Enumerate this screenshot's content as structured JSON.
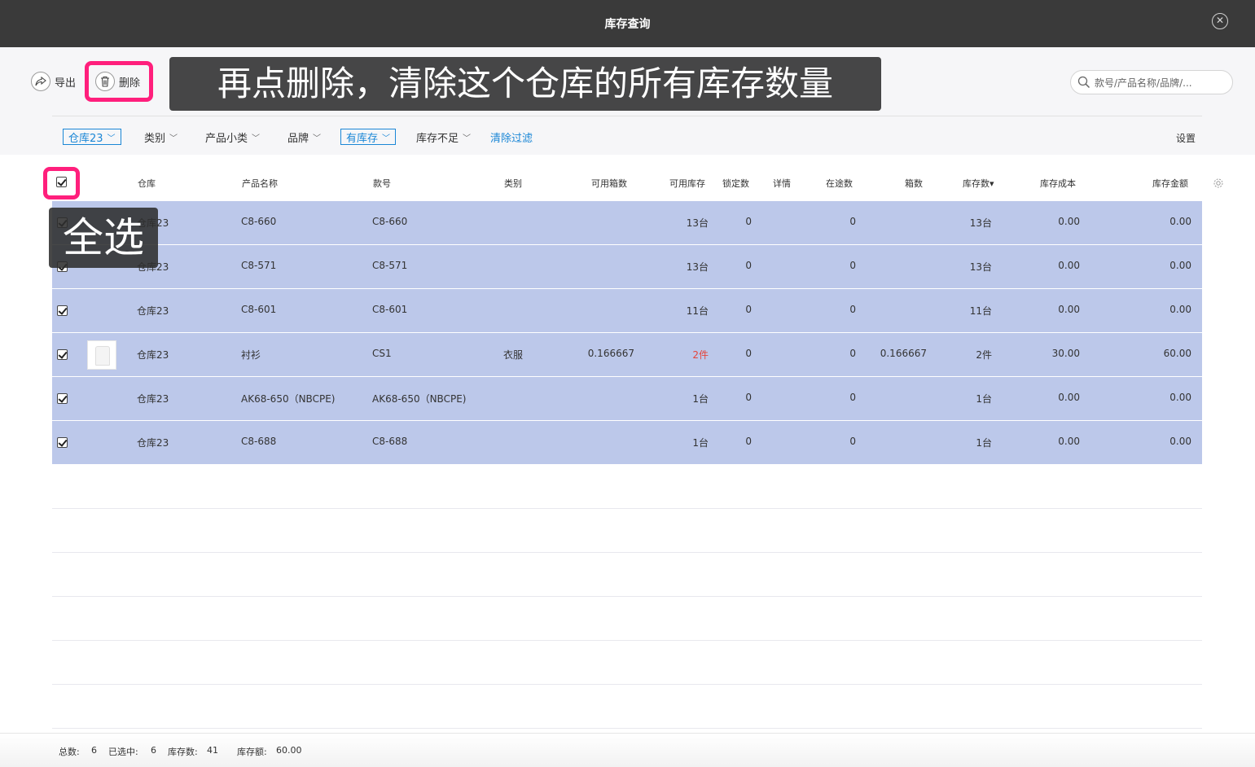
{
  "window": {
    "title": "库存查询"
  },
  "toolbar": {
    "export_label": "导出",
    "delete_label": "删除",
    "search_placeholder": "款号/产品名称/品牌/..."
  },
  "annotations": {
    "delete_caption": "再点删除，清除这个仓库的所有库存数量",
    "select_all_caption": "全选",
    "highlight_color": "#ff1f7c"
  },
  "filters": [
    {
      "label": "仓库23",
      "active": true
    },
    {
      "label": "类别",
      "active": false
    },
    {
      "label": "产品小类",
      "active": false
    },
    {
      "label": "品牌",
      "active": false
    },
    {
      "label": "有库存",
      "active": true
    },
    {
      "label": "库存不足",
      "active": false
    }
  ],
  "clear_filter_label": "清除过滤",
  "settings_label": "设置",
  "table": {
    "select_all_checked": true,
    "columns": [
      "仓库",
      "产品名称",
      "款号",
      "类别",
      "可用箱数",
      "可用库存",
      "锁定数",
      "详情",
      "在途数",
      "箱数",
      "库存数",
      "库存成本",
      "库存金额"
    ],
    "sort_indicator": "▾",
    "rows": [
      {
        "checked": true,
        "has_image": false,
        "warehouse": "仓库23",
        "product": "C8-660",
        "sku": "C8-660",
        "category": "",
        "avail_boxes": "",
        "avail_stock": "13台",
        "locked": "0",
        "detail": "",
        "in_transit": "0",
        "boxes": "",
        "stock": "13台",
        "cost": "0.00",
        "amount": "0.00"
      },
      {
        "checked": true,
        "has_image": false,
        "warehouse": "仓库23",
        "product": "C8-571",
        "sku": "C8-571",
        "category": "",
        "avail_boxes": "",
        "avail_stock": "13台",
        "locked": "0",
        "detail": "",
        "in_transit": "0",
        "boxes": "",
        "stock": "13台",
        "cost": "0.00",
        "amount": "0.00"
      },
      {
        "checked": true,
        "has_image": false,
        "warehouse": "仓库23",
        "product": "C8-601",
        "sku": "C8-601",
        "category": "",
        "avail_boxes": "",
        "avail_stock": "11台",
        "locked": "0",
        "detail": "",
        "in_transit": "0",
        "boxes": "",
        "stock": "11台",
        "cost": "0.00",
        "amount": "0.00"
      },
      {
        "checked": true,
        "has_image": true,
        "warehouse": "仓库23",
        "product": "衬衫",
        "sku": "CS1",
        "category": "衣服",
        "avail_boxes": "0.166667",
        "avail_stock": "2件",
        "avail_stock_warn": true,
        "locked": "0",
        "detail": "",
        "in_transit": "0",
        "boxes": "0.166667",
        "stock": "2件",
        "cost": "30.00",
        "amount": "60.00"
      },
      {
        "checked": true,
        "has_image": false,
        "warehouse": "仓库23",
        "product": "AK68-650（NBCPE)",
        "sku": "AK68-650（NBCPE)",
        "category": "",
        "avail_boxes": "",
        "avail_stock": "1台",
        "locked": "0",
        "detail": "",
        "in_transit": "0",
        "boxes": "",
        "stock": "1台",
        "cost": "0.00",
        "amount": "0.00"
      },
      {
        "checked": true,
        "has_image": false,
        "warehouse": "仓库23",
        "product": "C8-688",
        "sku": "C8-688",
        "category": "",
        "avail_boxes": "",
        "avail_stock": "1台",
        "locked": "0",
        "detail": "",
        "in_transit": "0",
        "boxes": "",
        "stock": "1台",
        "cost": "0.00",
        "amount": "0.00"
      }
    ],
    "empty_rows": 6
  },
  "footer": {
    "total_label": "总数:",
    "total_value": "6",
    "selected_label": "已选中:",
    "selected_value": "6",
    "stock_label": "库存数:",
    "stock_value": "41",
    "amount_label": "库存额:",
    "amount_value": "60.00"
  }
}
